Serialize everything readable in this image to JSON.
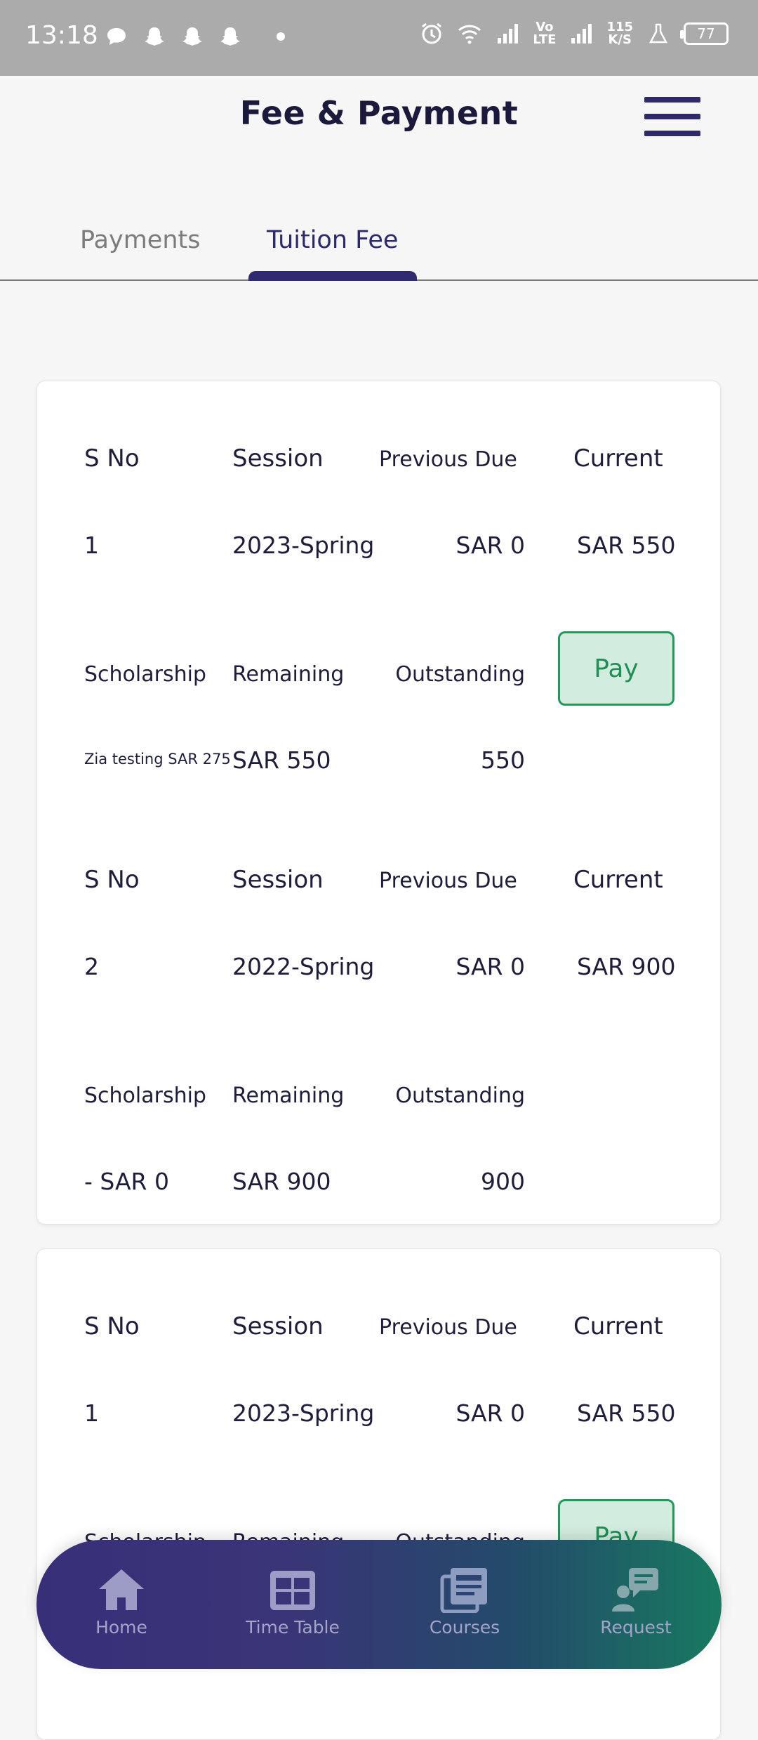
{
  "status_bar": {
    "time": "13:18",
    "speed_top": "115",
    "speed_bottom": "K/S",
    "volte_top": "Vo",
    "volte_bottom": "LTE",
    "battery": "77"
  },
  "header": {
    "title": "Fee & Payment"
  },
  "tabs": [
    {
      "label": "Payments",
      "active": false
    },
    {
      "label": "Tuition Fee",
      "active": true
    }
  ],
  "columns": {
    "s_no": "S No",
    "session": "Session",
    "previous_due": "Previous Due",
    "current": "Current",
    "scholarship": "Scholarship",
    "remaining": "Remaining",
    "outstanding": "Outstanding"
  },
  "cards": [
    {
      "records": [
        {
          "s_no": "1",
          "session": "2023-Spring",
          "previous_due": "SAR 0",
          "current": "SAR 550",
          "scholarship": "Zia testing SAR 275",
          "remaining": "SAR 550",
          "outstanding": "550",
          "action": "Pay"
        },
        {
          "s_no": "2",
          "session": "2022-Spring",
          "previous_due": "SAR 0",
          "current": "SAR 900",
          "scholarship": "- SAR 0",
          "remaining": "SAR 900",
          "outstanding": "900"
        }
      ]
    },
    {
      "records": [
        {
          "s_no": "1",
          "session": "2023-Spring",
          "previous_due": "SAR 0",
          "current": "SAR 550",
          "scholarship": "Scholarship",
          "remaining": "Remaining",
          "outstanding": "Outstanding",
          "action": "Pay"
        }
      ]
    }
  ],
  "bottom_nav": [
    {
      "label": "Home",
      "icon": "home-icon"
    },
    {
      "label": "Time Table",
      "icon": "table-icon"
    },
    {
      "label": "Courses",
      "icon": "courses-icon"
    },
    {
      "label": "Request",
      "icon": "request-icon"
    }
  ],
  "colors": {
    "primary": "#2f2b6e",
    "pay_border": "#1f9a5b",
    "pay_fill": "#d3ece0",
    "nav_gradient_start": "#382f79",
    "nav_gradient_end": "#187a60"
  }
}
